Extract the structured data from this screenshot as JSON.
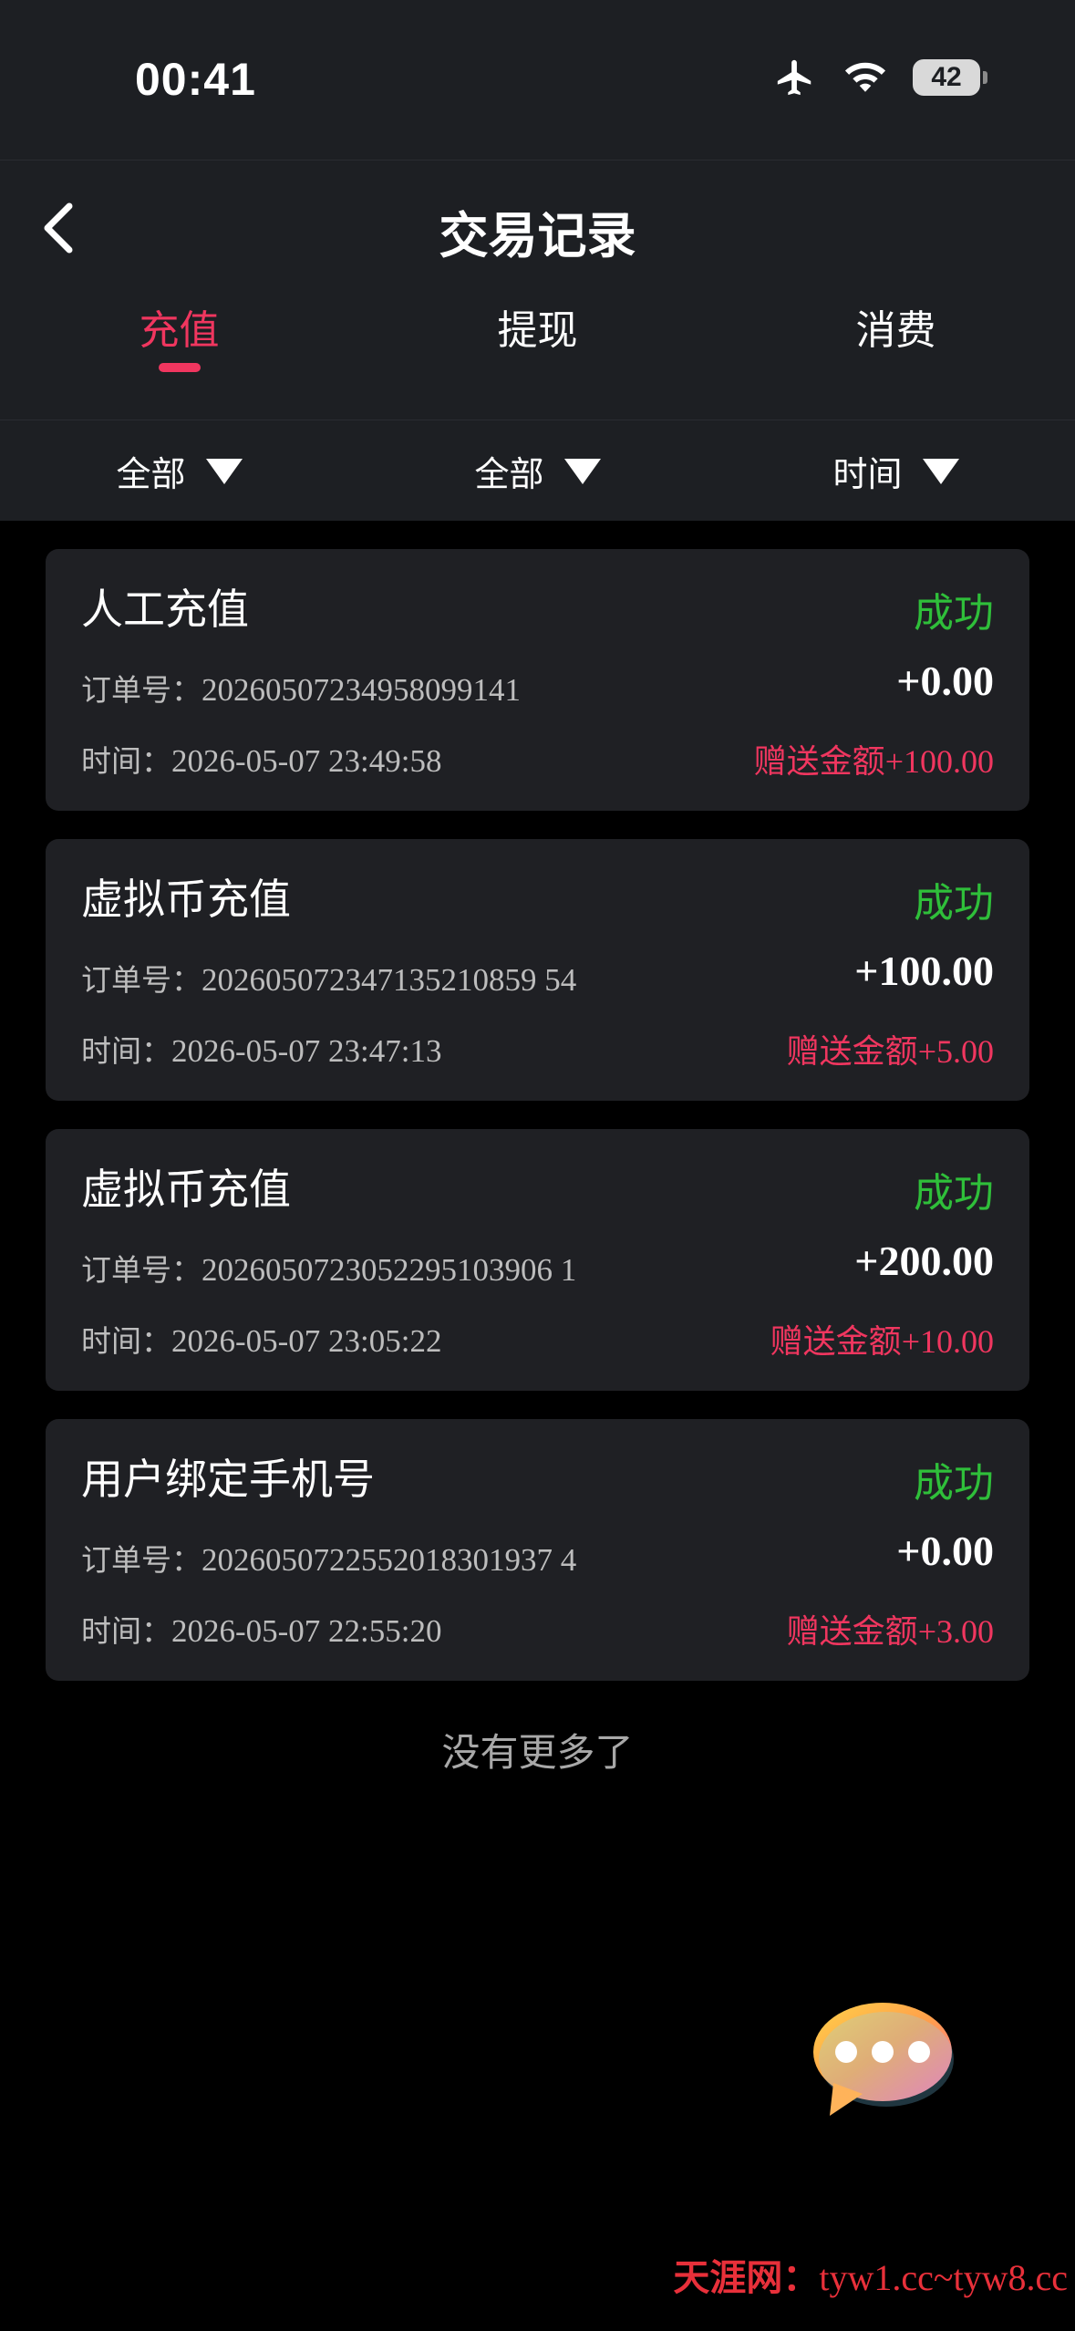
{
  "status_bar": {
    "time": "00:41",
    "battery": "42"
  },
  "header": {
    "title": "交易记录"
  },
  "tabs": [
    {
      "label": "充值",
      "active": true
    },
    {
      "label": "提现",
      "active": false
    },
    {
      "label": "消费",
      "active": false
    }
  ],
  "filters": [
    {
      "label": "全部"
    },
    {
      "label": "全部"
    },
    {
      "label": "时间"
    }
  ],
  "labels": {
    "order_prefix": "订单号：",
    "time_prefix": "时间：",
    "bonus_prefix": "赠送金额"
  },
  "records": [
    {
      "title": "人工充值",
      "status": "成功",
      "order_no": "20260507234958099141",
      "amount": "+0.00",
      "time": "2026-05-07 23:49:58",
      "bonus": "+100.00"
    },
    {
      "title": "虚拟币充值",
      "status": "成功",
      "order_no": "202605072347135210859 54",
      "amount": "+100.00",
      "time": "2026-05-07 23:47:13",
      "bonus": "+5.00"
    },
    {
      "title": "虚拟币充值",
      "status": "成功",
      "order_no": "2026050723052295103906 1",
      "amount": "+200.00",
      "time": "2026-05-07 23:05:22",
      "bonus": "+10.00"
    },
    {
      "title": "用户绑定手机号",
      "status": "成功",
      "order_no": "2026050722552018301937 4",
      "amount": "+0.00",
      "time": "2026-05-07 22:55:20",
      "bonus": "+3.00"
    }
  ],
  "footer": {
    "no_more": "没有更多了"
  },
  "watermark": {
    "name": "天涯网：",
    "url": "tyw1.cc~tyw8.cc"
  },
  "colors": {
    "accent": "#f0365f",
    "success": "#2fbf3a",
    "panel": "#1d1f23",
    "card": "#1f2024"
  }
}
